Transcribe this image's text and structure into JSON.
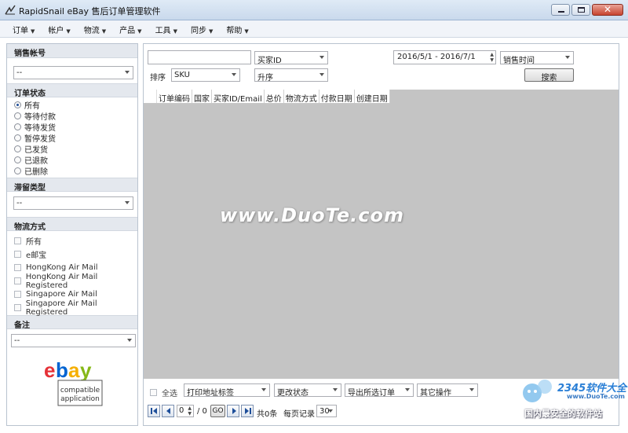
{
  "window": {
    "title": "RapidSnail eBay 售后订单管理软件"
  },
  "menu": [
    {
      "label": "订单"
    },
    {
      "label": "帐户"
    },
    {
      "label": "物流"
    },
    {
      "label": "产品"
    },
    {
      "label": "工具"
    },
    {
      "label": "同步"
    },
    {
      "label": "帮助"
    }
  ],
  "sidebar": {
    "account": {
      "heading": "销售帐号",
      "value": "--"
    },
    "order_status": {
      "heading": "订单状态",
      "options": [
        "所有",
        "等待付款",
        "等待发货",
        "暂停发货",
        "已发货",
        "已退款",
        "已删除"
      ],
      "selected": "所有"
    },
    "hold_type": {
      "heading": "滞留类型",
      "value": "--"
    },
    "shipping": {
      "heading": "物流方式",
      "options": [
        "所有",
        "e邮宝",
        "HongKong Air Mail",
        "HongKong Air Mail Registered",
        "Singapore Air Mail",
        "Singapore Air Mail Registered"
      ]
    },
    "notes": {
      "heading": "备注",
      "value": "--"
    },
    "logo": {
      "line1": "compatible",
      "line2": "application"
    }
  },
  "filter": {
    "search_value": "",
    "buyer_field": "买家ID",
    "date_range": "2016/5/1 - 2016/7/1",
    "date_type": "销售时间",
    "sort_label": "排序",
    "sort_field": "SKU",
    "sort_order": "升序",
    "search_button": "搜索"
  },
  "grid": {
    "columns": [
      "订单编码",
      "国家",
      "买家ID/Email",
      "总价",
      "物流方式",
      "付款日期",
      "创建日期"
    ]
  },
  "bottom": {
    "select_all": "全选",
    "print_label": "打印地址标签",
    "change_status": "更改状态",
    "export": "导出所选订单",
    "other": "其它操作",
    "page_value": "0",
    "page_total": "/ 0",
    "go": "GO",
    "total": "共0条",
    "per_page_label": "每页记录",
    "per_page": "30"
  },
  "watermarks": {
    "center": "www.DuoTe.com",
    "corner_title": "2345软件大全",
    "corner_url": "www.DuoTe.com",
    "corner_slogan": "国内最安全的软件站"
  },
  "colors": {
    "accent": "#1d4e9a",
    "grid_bg": "#c4c4c4",
    "titlebar": "#c9d9ec"
  }
}
